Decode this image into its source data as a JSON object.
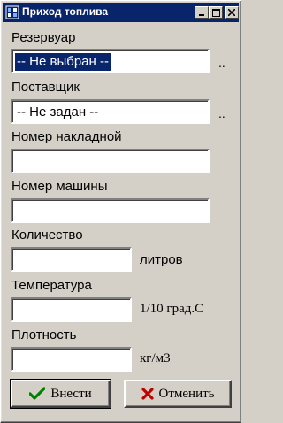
{
  "window": {
    "title": "Приход топлива",
    "icon": "app-grid-icon",
    "controls": [
      "minimize-icon",
      "maximize-icon",
      "close-icon"
    ]
  },
  "reservoir": {
    "label": "Резервуар",
    "value": "-- Не выбран --",
    "browse": ".."
  },
  "supplier": {
    "label": "Поставщик",
    "value": "-- Не задан --",
    "browse": ".."
  },
  "invoice": {
    "label": "Номер накладной",
    "value": ""
  },
  "vehicle": {
    "label": "Номер машины",
    "value": ""
  },
  "quantity": {
    "label": "Количество",
    "value": "",
    "unit": "литров"
  },
  "temperature": {
    "label": "Температура",
    "value": "",
    "unit": "1/10 град.С"
  },
  "density": {
    "label": "Плотность",
    "value": "",
    "unit": "кг/м3"
  },
  "buttons": {
    "submit": {
      "label": "Внести",
      "icon": "checkmark-icon",
      "color": "#008000"
    },
    "cancel": {
      "label": "Отменить",
      "icon": "cross-icon",
      "color": "#c00000"
    }
  }
}
